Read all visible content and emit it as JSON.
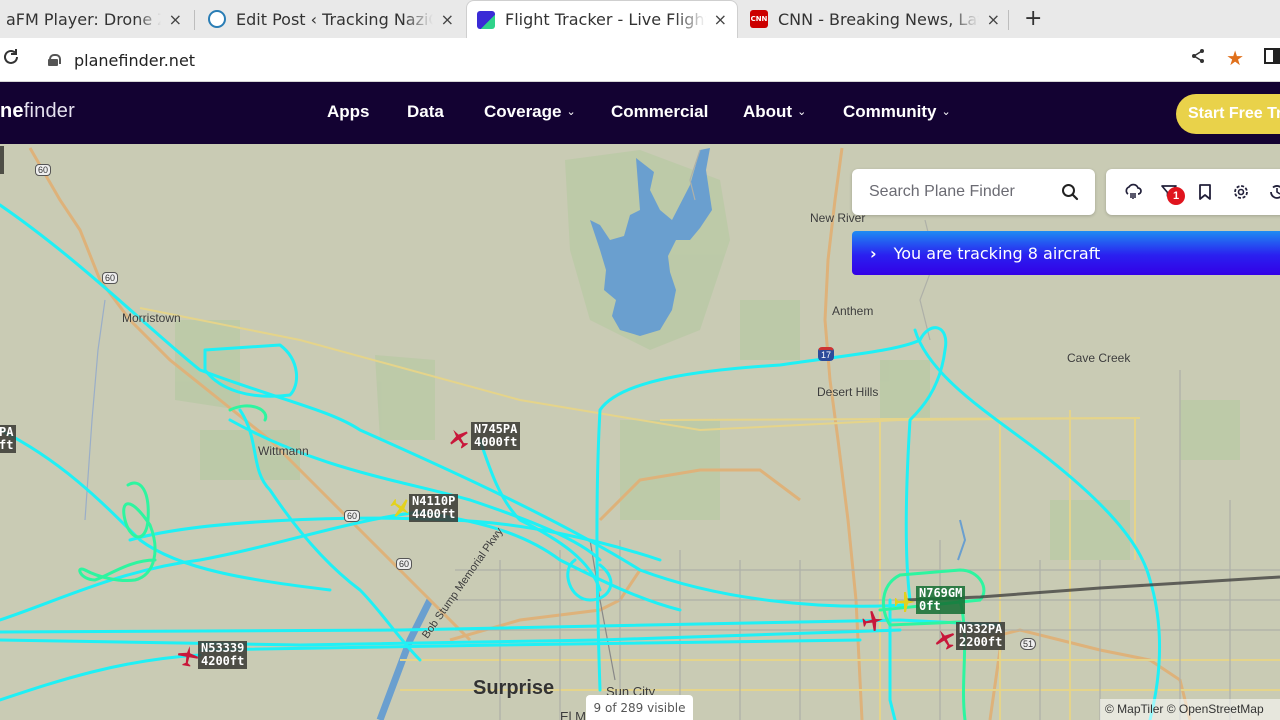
{
  "browser": {
    "tabs": [
      {
        "title": "aFM Player: Drone Zo",
        "favicon": "radio-icon",
        "active": false
      },
      {
        "title": "Edit Post ‹ Tracking NaziG",
        "favicon": "wordpress-icon",
        "active": false
      },
      {
        "title": "Flight Tracker - Live Flight",
        "favicon": "planefinder-icon",
        "active": true
      },
      {
        "title": "CNN - Breaking News, Lat",
        "favicon": "cnn-icon",
        "active": false
      }
    ],
    "close_glyph": "×",
    "new_tab_glyph": "+",
    "url": "planefinder.net",
    "icons": [
      "share-icon",
      "bookmark-star-icon",
      "side-panel-icon"
    ]
  },
  "site": {
    "logo_bold": "ne",
    "logo_light": "finder",
    "nav": [
      {
        "label": "Apps",
        "dropdown": false
      },
      {
        "label": "Data",
        "dropdown": false
      },
      {
        "label": "Coverage",
        "dropdown": true
      },
      {
        "label": "Commercial",
        "dropdown": false
      },
      {
        "label": "About",
        "dropdown": true
      },
      {
        "label": "Community",
        "dropdown": true
      }
    ],
    "cta_label": "Start Free Tr"
  },
  "map": {
    "search_placeholder": "Search Plane Finder",
    "filter_badge": "1",
    "toolbar_icons": [
      "weather-icon",
      "filter-icon",
      "bookmark-icon",
      "settings-icon",
      "history-icon"
    ],
    "tracking_text": "You are tracking 8 aircraft",
    "visible_count": "9 of 289 visible",
    "attribution": "© MapTiler © OpenStreetMap",
    "places": [
      {
        "name": "New River"
      },
      {
        "name": "Anthem"
      },
      {
        "name": "Cave Creek"
      },
      {
        "name": "Desert Hills"
      },
      {
        "name": "Morristown"
      },
      {
        "name": "Wittmann"
      },
      {
        "name": "Surprise"
      },
      {
        "name": "Sun City"
      },
      {
        "name": "El Mirage"
      },
      {
        "name": "Bob Stump Memorial Pkwy"
      }
    ],
    "shields": [
      "60",
      "60",
      "17",
      "60",
      "60",
      "51"
    ],
    "aircraft": [
      {
        "callsign": "N745PA",
        "altitude": "4000ft",
        "color": "#c8173a"
      },
      {
        "callsign": "N4110P",
        "altitude": "4400ft",
        "color": "#e3d21c"
      },
      {
        "callsign": "N769GM",
        "altitude": "0ft",
        "color": "#e3d21c",
        "selected": true
      },
      {
        "callsign": "N332PA",
        "altitude": "2200ft",
        "color": "#c8173a"
      },
      {
        "callsign": "N53339",
        "altitude": "4200ft",
        "color": "#c8173a"
      },
      {
        "callsign": "",
        "altitude": "",
        "color": "#c8173a"
      }
    ],
    "edge_labels": [
      {
        "text": "PA"
      },
      {
        "text": "ft"
      }
    ],
    "track_colors": {
      "primary": "#1ff0f5",
      "secondary": "#2ef5a0"
    }
  }
}
